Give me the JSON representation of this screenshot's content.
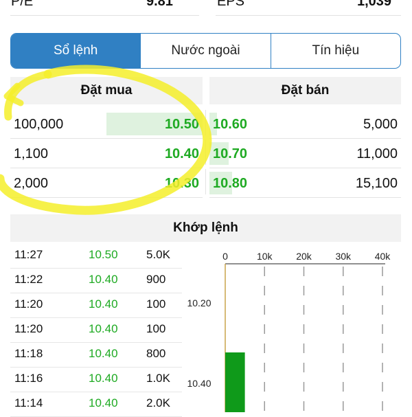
{
  "stats": {
    "pe_label": "P/E",
    "pe_value": "9.81",
    "eps_label": "EPS",
    "eps_value": "1,039"
  },
  "tabs": [
    {
      "label": "Sổ lệnh",
      "active": true
    },
    {
      "label": "Nước ngoài",
      "active": false
    },
    {
      "label": "Tín hiệu",
      "active": false
    }
  ],
  "order_book": {
    "buy_header": "Đặt mua",
    "sell_header": "Đặt bán",
    "rows": [
      {
        "buy_vol": "100,000",
        "buy_price": "10.50",
        "sell_price": "10.60",
        "sell_vol": "5,000"
      },
      {
        "buy_vol": "1,100",
        "buy_price": "10.40",
        "sell_price": "10.70",
        "sell_vol": "11,000"
      },
      {
        "buy_vol": "2,000",
        "buy_price": "10.30",
        "sell_price": "10.80",
        "sell_vol": "15,100"
      }
    ],
    "buy_fill": [
      1.0,
      0.0,
      0.0
    ],
    "sell_fill": [
      0.04,
      0.1,
      0.12
    ],
    "accent": "#1eaa22"
  },
  "matched": {
    "header": "Khớp lệnh",
    "trades": [
      {
        "time": "11:27",
        "price": "10.50",
        "vol": "5.0K"
      },
      {
        "time": "11:22",
        "price": "10.40",
        "vol": "900"
      },
      {
        "time": "11:20",
        "price": "10.40",
        "vol": "100"
      },
      {
        "time": "11:20",
        "price": "10.40",
        "vol": "100"
      },
      {
        "time": "11:18",
        "price": "10.40",
        "vol": "800"
      },
      {
        "time": "11:16",
        "price": "10.40",
        "vol": "1.0K"
      },
      {
        "time": "11:14",
        "price": "10.40",
        "vol": "2.0K"
      }
    ]
  },
  "chart_data": {
    "type": "bar",
    "orientation": "horizontal",
    "x_ticks": [
      "0",
      "10k",
      "20k",
      "30k",
      "40k"
    ],
    "xlim": [
      0,
      40000
    ],
    "categories": [
      "10.20",
      "10.40"
    ],
    "values": [
      0,
      5000
    ],
    "bar_color": "#0f9a1a",
    "grid": "dashed"
  }
}
